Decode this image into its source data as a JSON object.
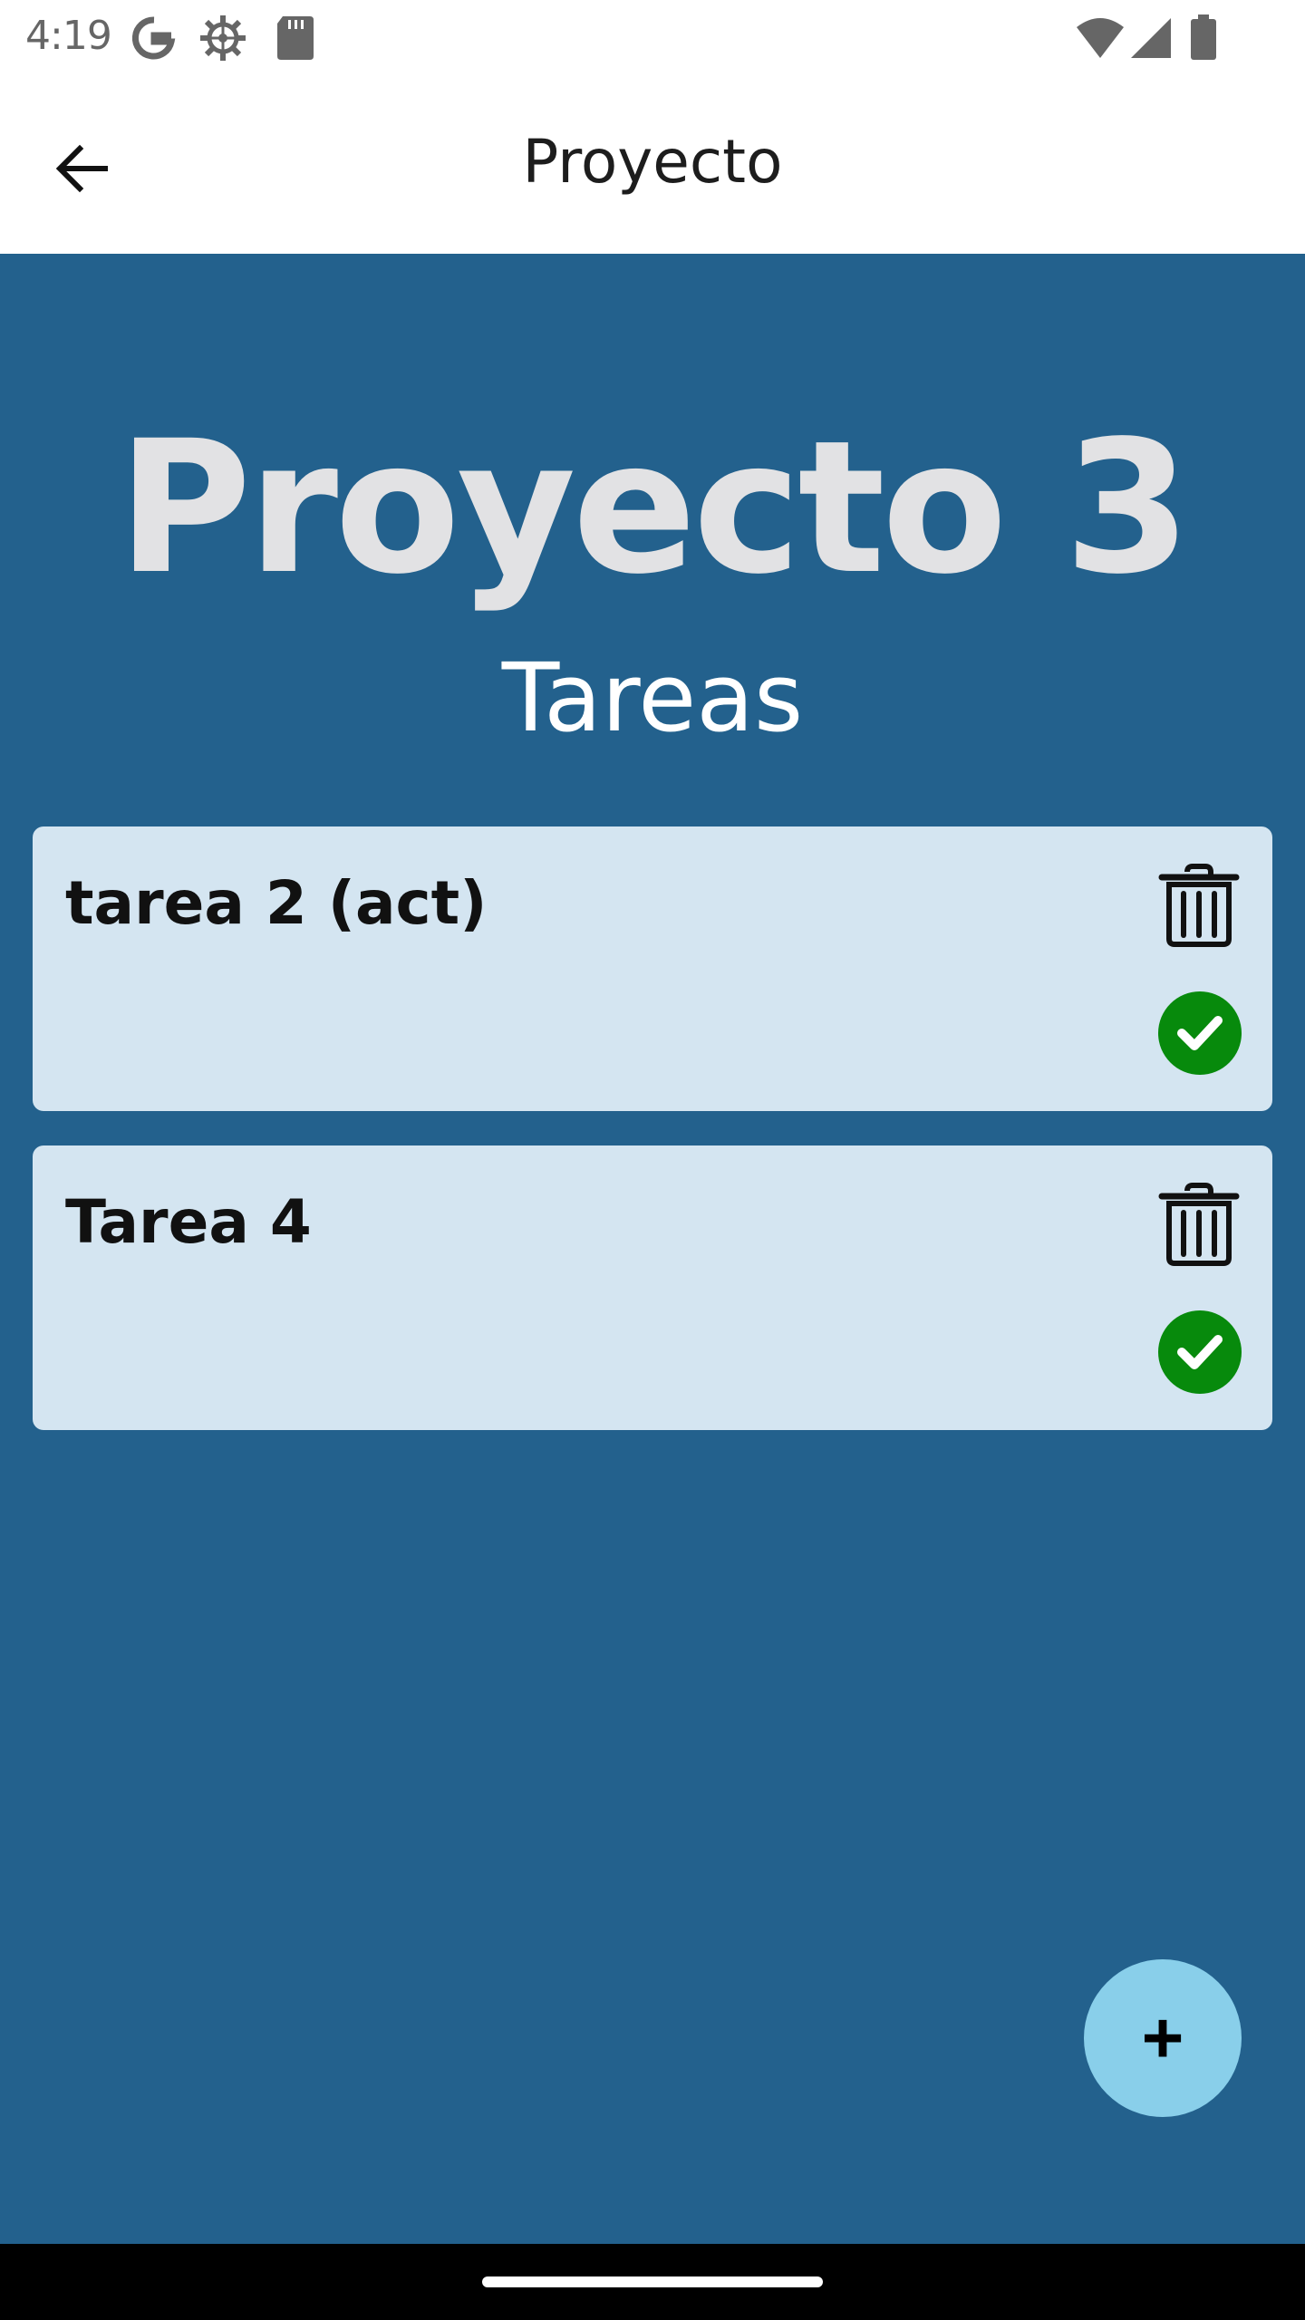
{
  "status_bar": {
    "time": "4:19",
    "left_icons": [
      "google-icon",
      "settings-gear-icon",
      "sd-card-icon"
    ],
    "right_icons": [
      "wifi-icon",
      "cell-signal-icon",
      "battery-icon"
    ]
  },
  "app_bar": {
    "title": "Proyecto",
    "back_icon": "arrow-left-icon"
  },
  "main": {
    "project_title": "Proyecto 3",
    "section_title": "Tareas",
    "tasks": [
      {
        "name": "tarea 2 (act)",
        "delete_icon": "trash-icon",
        "complete_icon": "check-circle-icon"
      },
      {
        "name": "Tarea 4",
        "delete_icon": "trash-icon",
        "complete_icon": "check-circle-icon"
      }
    ]
  },
  "fab": {
    "label": "+"
  },
  "colors": {
    "background": "#23618d",
    "card": "#d4e5f1",
    "check_green": "#078a0c",
    "fab": "#89cfea",
    "title_text": "#e2e2e4"
  }
}
